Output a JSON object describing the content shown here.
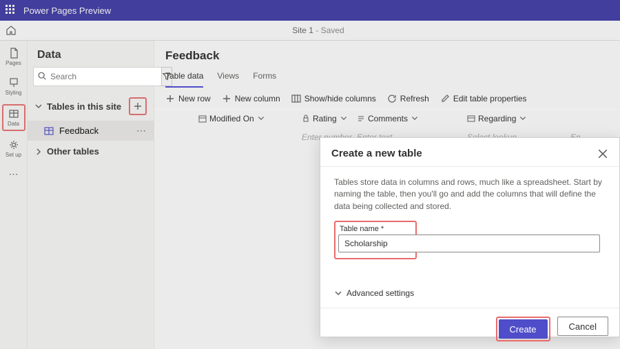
{
  "topbar": {
    "product": "Power Pages Preview"
  },
  "crumb": {
    "site": "Site 1",
    "status": "Saved"
  },
  "rail": {
    "pages": "Pages",
    "styling": "Styling",
    "data": "Data",
    "setup": "Set up"
  },
  "datapanel": {
    "title": "Data",
    "search_placeholder": "Search",
    "section_tables": "Tables in this site",
    "table_feedback": "Feedback",
    "section_other": "Other tables"
  },
  "main": {
    "heading": "Feedback",
    "tabs": {
      "data": "Table data",
      "views": "Views",
      "forms": "Forms"
    },
    "cmds": {
      "newrow": "New row",
      "newcol": "New column",
      "showhide": "Show/hide columns",
      "refresh": "Refresh",
      "editprops": "Edit table properties"
    },
    "cols": {
      "modified": "Modified On",
      "rating": "Rating",
      "comments": "Comments",
      "regarding": "Regarding"
    },
    "placeholders": {
      "number": "Enter number",
      "text": "Enter text",
      "lookup": "Select lookup",
      "right": "En"
    }
  },
  "dialog": {
    "title": "Create a new table",
    "desc": "Tables store data in columns and rows, much like a spreadsheet. Start by naming the table, then you'll go and add the columns that will define the data being collected and stored.",
    "field_label": "Table name *",
    "field_value": "Scholarship",
    "advanced": "Advanced settings",
    "create": "Create",
    "cancel": "Cancel"
  }
}
